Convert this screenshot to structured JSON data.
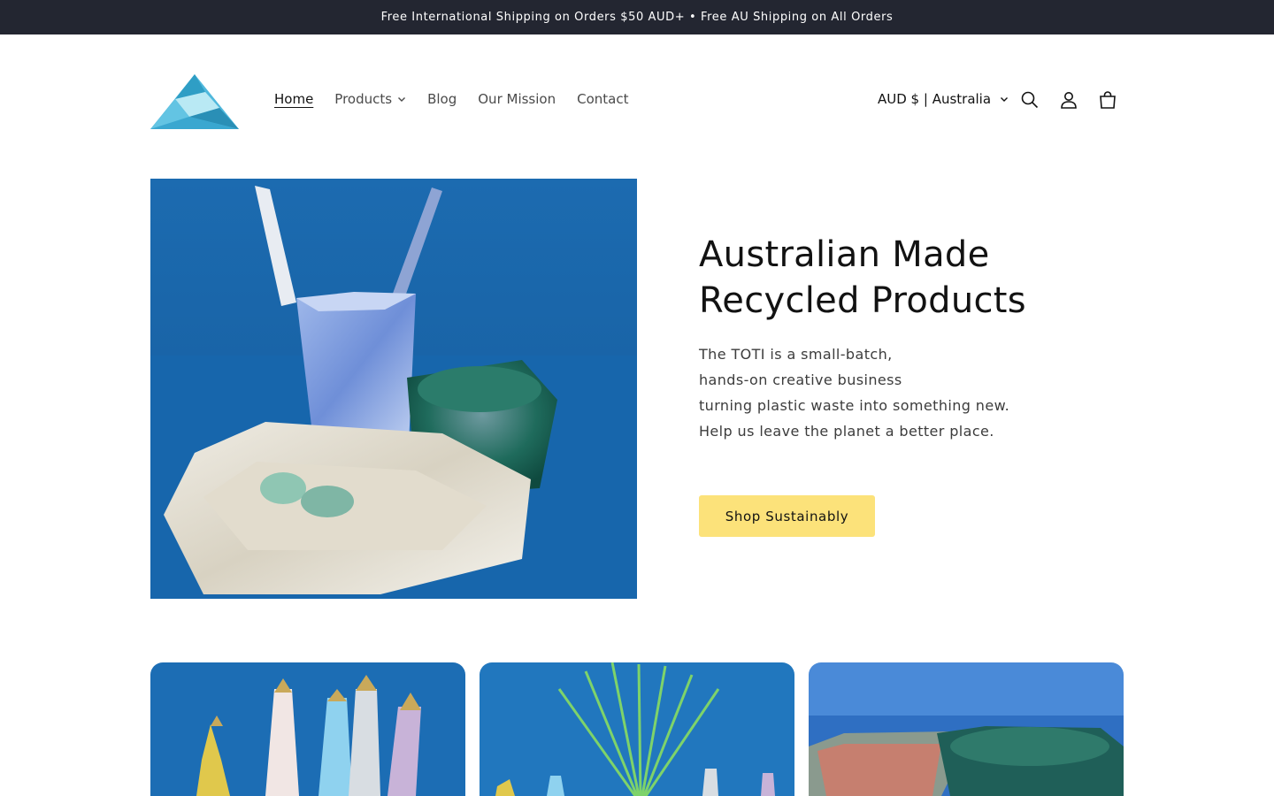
{
  "announcement": {
    "text": "Free International Shipping on Orders $50 AUD+ • Free AU Shipping on All Orders"
  },
  "header": {
    "logo_icon": "mountain-logo-icon",
    "nav": [
      {
        "label": "Home",
        "active": true
      },
      {
        "label": "Products",
        "has_dropdown": true
      },
      {
        "label": "Blog"
      },
      {
        "label": "Our Mission"
      },
      {
        "label": "Contact"
      }
    ],
    "locale": {
      "label": "AUD $ | Australia"
    },
    "icons": [
      "search-icon",
      "account-icon",
      "cart-icon"
    ]
  },
  "hero": {
    "title_line1": "Australian Made",
    "title_line2": "Recycled Products",
    "copy": [
      "The TOTI is a small-batch,",
      "hands-on creative business",
      "turning plastic waste into something new.",
      "Help us leave the planet a better place."
    ],
    "cta": "Shop Sustainably"
  },
  "colors": {
    "announcement_bg": "#232631",
    "cta_bg": "#fce27a",
    "accent_blue": "#1f6fb4",
    "logo_blue": "#4fb8dc"
  }
}
